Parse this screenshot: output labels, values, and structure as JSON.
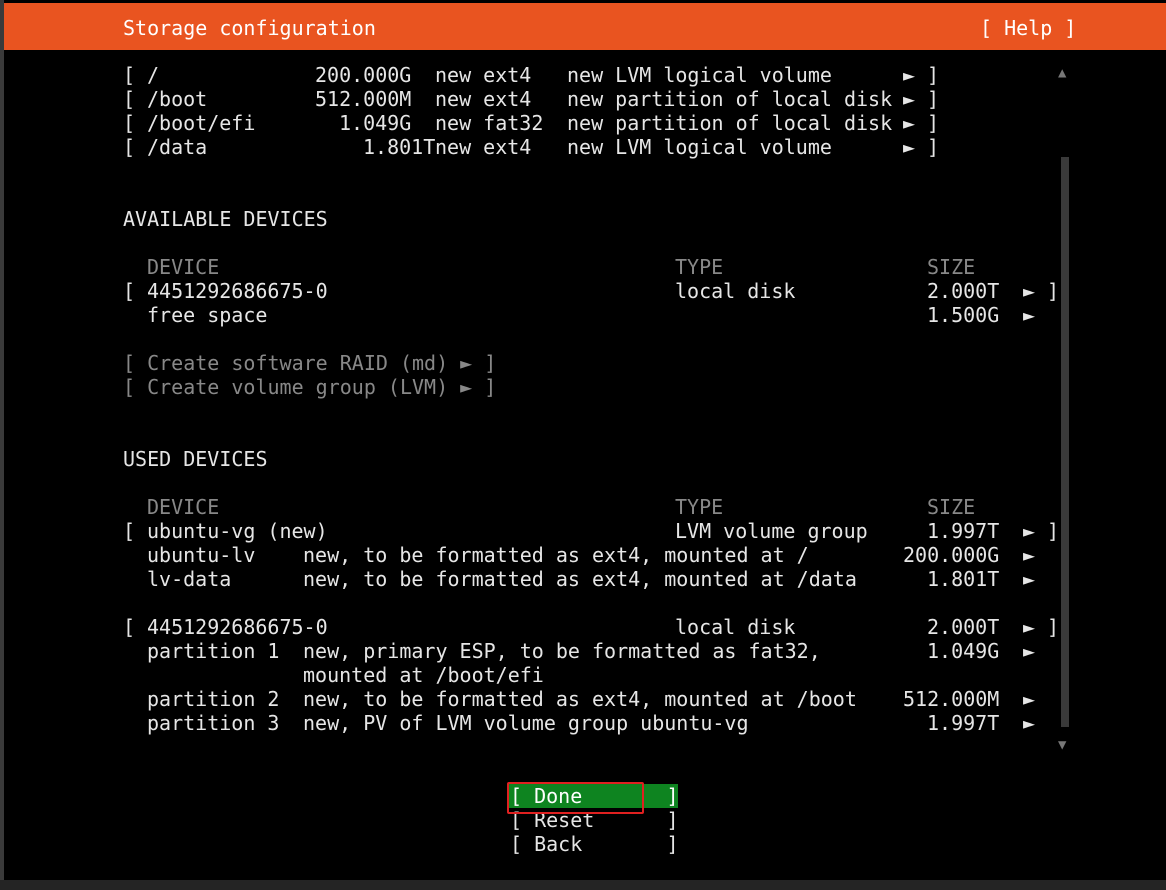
{
  "header": {
    "title": "Storage configuration",
    "help": "[ Help ]"
  },
  "summary": {
    "rows": [
      {
        "mount": "/",
        "size": "200.000G",
        "action": "new ext4",
        "desc": "new LVM logical volume"
      },
      {
        "mount": "/boot",
        "size": "512.000M",
        "action": "new ext4",
        "desc": "new partition of local disk"
      },
      {
        "mount": "/boot/efi",
        "size": "1.049G",
        "action": "new fat32",
        "desc": "new partition of local disk"
      },
      {
        "mount": "/data",
        "size": "1.801T",
        "action": "new ext4",
        "desc": "new LVM logical volume"
      }
    ]
  },
  "glyphs": {
    "open": "[",
    "close": "]",
    "arrow": "►"
  },
  "available": {
    "heading": "AVAILABLE DEVICES",
    "columns": {
      "device": "DEVICE",
      "type": "TYPE",
      "size": "SIZE"
    },
    "disk": {
      "device": "4451292686675-0",
      "type": "local disk",
      "size": "2.000T"
    },
    "free": {
      "label": "free space",
      "size": "1.500G"
    },
    "actions": [
      "[ Create software RAID (md) ► ]",
      "[ Create volume group (LVM) ► ]"
    ]
  },
  "used": {
    "heading": "USED DEVICES",
    "columns": {
      "device": "DEVICE",
      "type": "TYPE",
      "size": "SIZE"
    },
    "vg": {
      "device": "ubuntu-vg (new)",
      "type": "LVM volume group",
      "size": "1.997T",
      "children": [
        {
          "name": "ubuntu-lv",
          "desc": "new, to be formatted as ext4, mounted at /",
          "size": "200.000G"
        },
        {
          "name": "lv-data",
          "desc": "new, to be formatted as ext4, mounted at /data",
          "size": "1.801T"
        }
      ]
    },
    "disk": {
      "device": "4451292686675-0",
      "type": "local disk",
      "size": "2.000T",
      "partitions": [
        {
          "name": "partition 1",
          "desc": "new, primary ESP, to be formatted as fat32,",
          "desc2": "mounted at /boot/efi",
          "size": "1.049G"
        },
        {
          "name": "partition 2",
          "desc": "new, to be formatted as ext4, mounted at /boot",
          "size": "512.000M"
        },
        {
          "name": "partition 3",
          "desc": "new, PV of LVM volume group ubuntu-vg",
          "size": "1.997T"
        }
      ]
    }
  },
  "scroll": {
    "up": "▲",
    "down": "▼"
  },
  "buttons": {
    "done": "[ Done       ]",
    "reset": "[ Reset      ]",
    "back": "[ Back       ]"
  }
}
